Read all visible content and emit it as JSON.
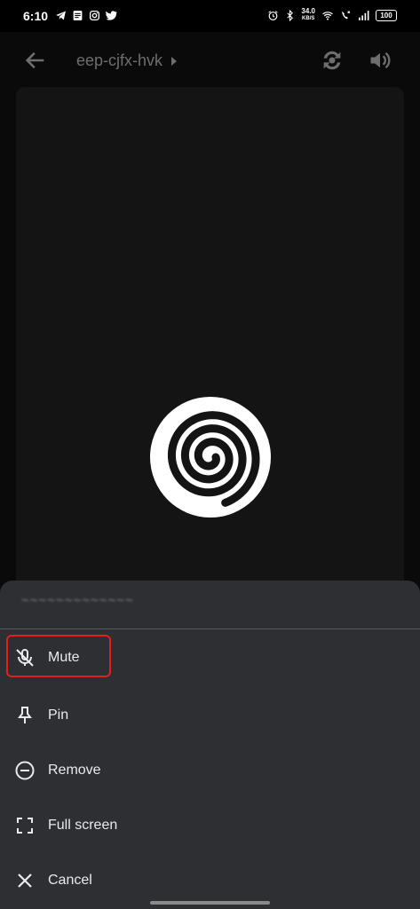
{
  "status_bar": {
    "time": "6:10",
    "net_speed_value": "34.0",
    "net_speed_unit": "KB/S",
    "battery": "100",
    "left_icons": [
      "telegram-icon",
      "document-icon",
      "instagram-icon",
      "twitter-icon"
    ],
    "right_icons": [
      "alarm-icon",
      "bluetooth-icon",
      "wifi-icon",
      "volte-icon",
      "signal-icon",
      "battery-icon"
    ]
  },
  "top_bar": {
    "meeting_code": "eep-cjfx-hvk"
  },
  "participant": {
    "avatar_icon": "spiral-avatar-icon"
  },
  "sheet": {
    "participant_name_redacted": "~~~~~~~~~~~~~",
    "menu": [
      {
        "label": "Mute",
        "icon": "mic-off-icon"
      },
      {
        "label": "Pin",
        "icon": "pin-icon"
      },
      {
        "label": "Remove",
        "icon": "remove-circle-icon"
      },
      {
        "label": "Full screen",
        "icon": "fullscreen-icon"
      },
      {
        "label": "Cancel",
        "icon": "close-icon"
      }
    ]
  },
  "colors": {
    "sheet_bg": "#2e2f33",
    "highlight": "#e0201e",
    "text": "#e8eaed"
  }
}
